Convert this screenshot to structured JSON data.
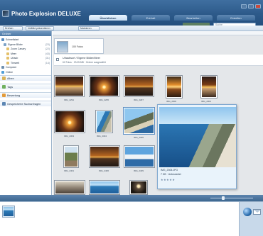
{
  "app": {
    "title": "Photo Explosion DELUXE",
    "main_tabs": [
      "Überblicken",
      "Ent-tait",
      "Bearbeiten",
      "Erstellen"
    ],
    "search_placeholder": "Suche"
  },
  "toolbar": {
    "btn1": "Drehen",
    "btn2": "Vollbild präsentieren",
    "btn3": "Markieren"
  },
  "sidebar": {
    "header": "Ordner",
    "tree": [
      {
        "label": "Schnellstart",
        "count": ""
      },
      {
        "label": "Eigene Bilder",
        "count": "(23)"
      },
      {
        "label": "Zoom Canary",
        "count": "(22)"
      },
      {
        "label": "Meer",
        "count": "(43)"
      },
      {
        "label": "Urlaub",
        "count": "(31)"
      },
      {
        "label": "Tierwelt",
        "count": "(14)"
      },
      {
        "label": "Computer",
        "count": ""
      },
      {
        "label": "Online",
        "count": ""
      }
    ],
    "nav": [
      "Alben",
      "Tags",
      "Bewertung",
      "Gespeicherte Suchanfragen"
    ]
  },
  "album": {
    "label": "100 Fotos"
  },
  "group": {
    "title": "Urlaubsort / Eigene Bilder/Meer",
    "meta": "62 Fotos · 23.05.MB · Ordner ausgewählt"
  },
  "photos": [
    {
      "name": "IMG_2291"
    },
    {
      "name": "IMG_2295"
    },
    {
      "name": "IMG_2297"
    },
    {
      "name": "IMG_2300"
    },
    {
      "name": "IMG_2301"
    },
    {
      "name": "IMG_2303"
    },
    {
      "name": "IMG_2304"
    },
    {
      "name": "IMG_2305"
    },
    {
      "name": "IMG_2401"
    },
    {
      "name": "IMG_2406"
    },
    {
      "name": "IMG_2409"
    }
  ],
  "preview": {
    "name": "IMG_2305.JPG",
    "size": "7 KB · Unbewertet",
    "stars": "★★★★★"
  }
}
